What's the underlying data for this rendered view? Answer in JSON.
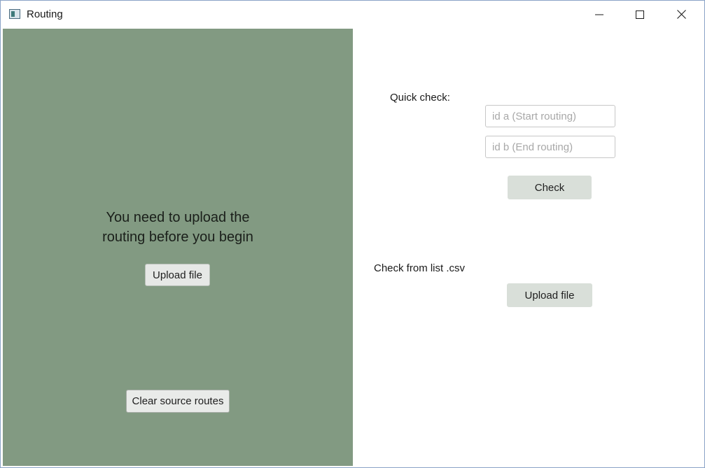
{
  "window": {
    "title": "Routing",
    "controls": {
      "minimize_icon": "minimize-icon",
      "maximize_icon": "maximize-icon",
      "close_icon": "close-icon"
    }
  },
  "left_panel": {
    "background": "#829a82",
    "message_line1": "You need to upload the",
    "message_line2": "routing before you begin",
    "upload_button": "Upload file",
    "clear_button": "Clear source routes"
  },
  "right_panel": {
    "quick_check_label": "Quick check:",
    "id_a_placeholder": "id a (Start routing)",
    "id_b_placeholder": "id b (End routing)",
    "check_button": "Check",
    "list_label": "Check from list .csv",
    "upload_button": "Upload file"
  }
}
